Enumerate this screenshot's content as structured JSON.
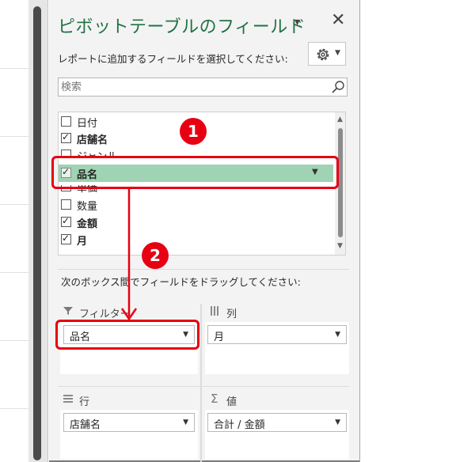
{
  "pane": {
    "title": "ピボットテーブルのフィールド",
    "choose_label": "レポートに追加するフィールドを選択してください:",
    "search_placeholder": "検索",
    "drag_label": "次のボックス間でフィールドをドラッグしてください:"
  },
  "fields": [
    {
      "label": "日付",
      "checked": false,
      "bold": false
    },
    {
      "label": "店舗名",
      "checked": true,
      "bold": true
    },
    {
      "label": "ジャンル",
      "checked": false,
      "bold": false
    },
    {
      "label": "品名",
      "checked": true,
      "bold": true
    },
    {
      "label": "単価",
      "checked": false,
      "bold": false
    },
    {
      "label": "数量",
      "checked": false,
      "bold": false
    },
    {
      "label": "金額",
      "checked": true,
      "bold": true
    },
    {
      "label": "月",
      "checked": true,
      "bold": true
    }
  ],
  "areas": {
    "filter": {
      "header": "フィルター",
      "icon": "filter-icon",
      "item": "品名"
    },
    "columns": {
      "header": "列",
      "icon": "columns-icon",
      "item": "月"
    },
    "rows": {
      "header": "行",
      "icon": "rows-icon",
      "item": "店舗名"
    },
    "values": {
      "header": "値",
      "icon": "sigma-icon",
      "item": "合計 / 金額"
    }
  },
  "callouts": {
    "one": "1",
    "two": "2"
  },
  "colors": {
    "accent": "#217346",
    "highlight": "#9fd3b3",
    "annotation": "#e60012"
  }
}
